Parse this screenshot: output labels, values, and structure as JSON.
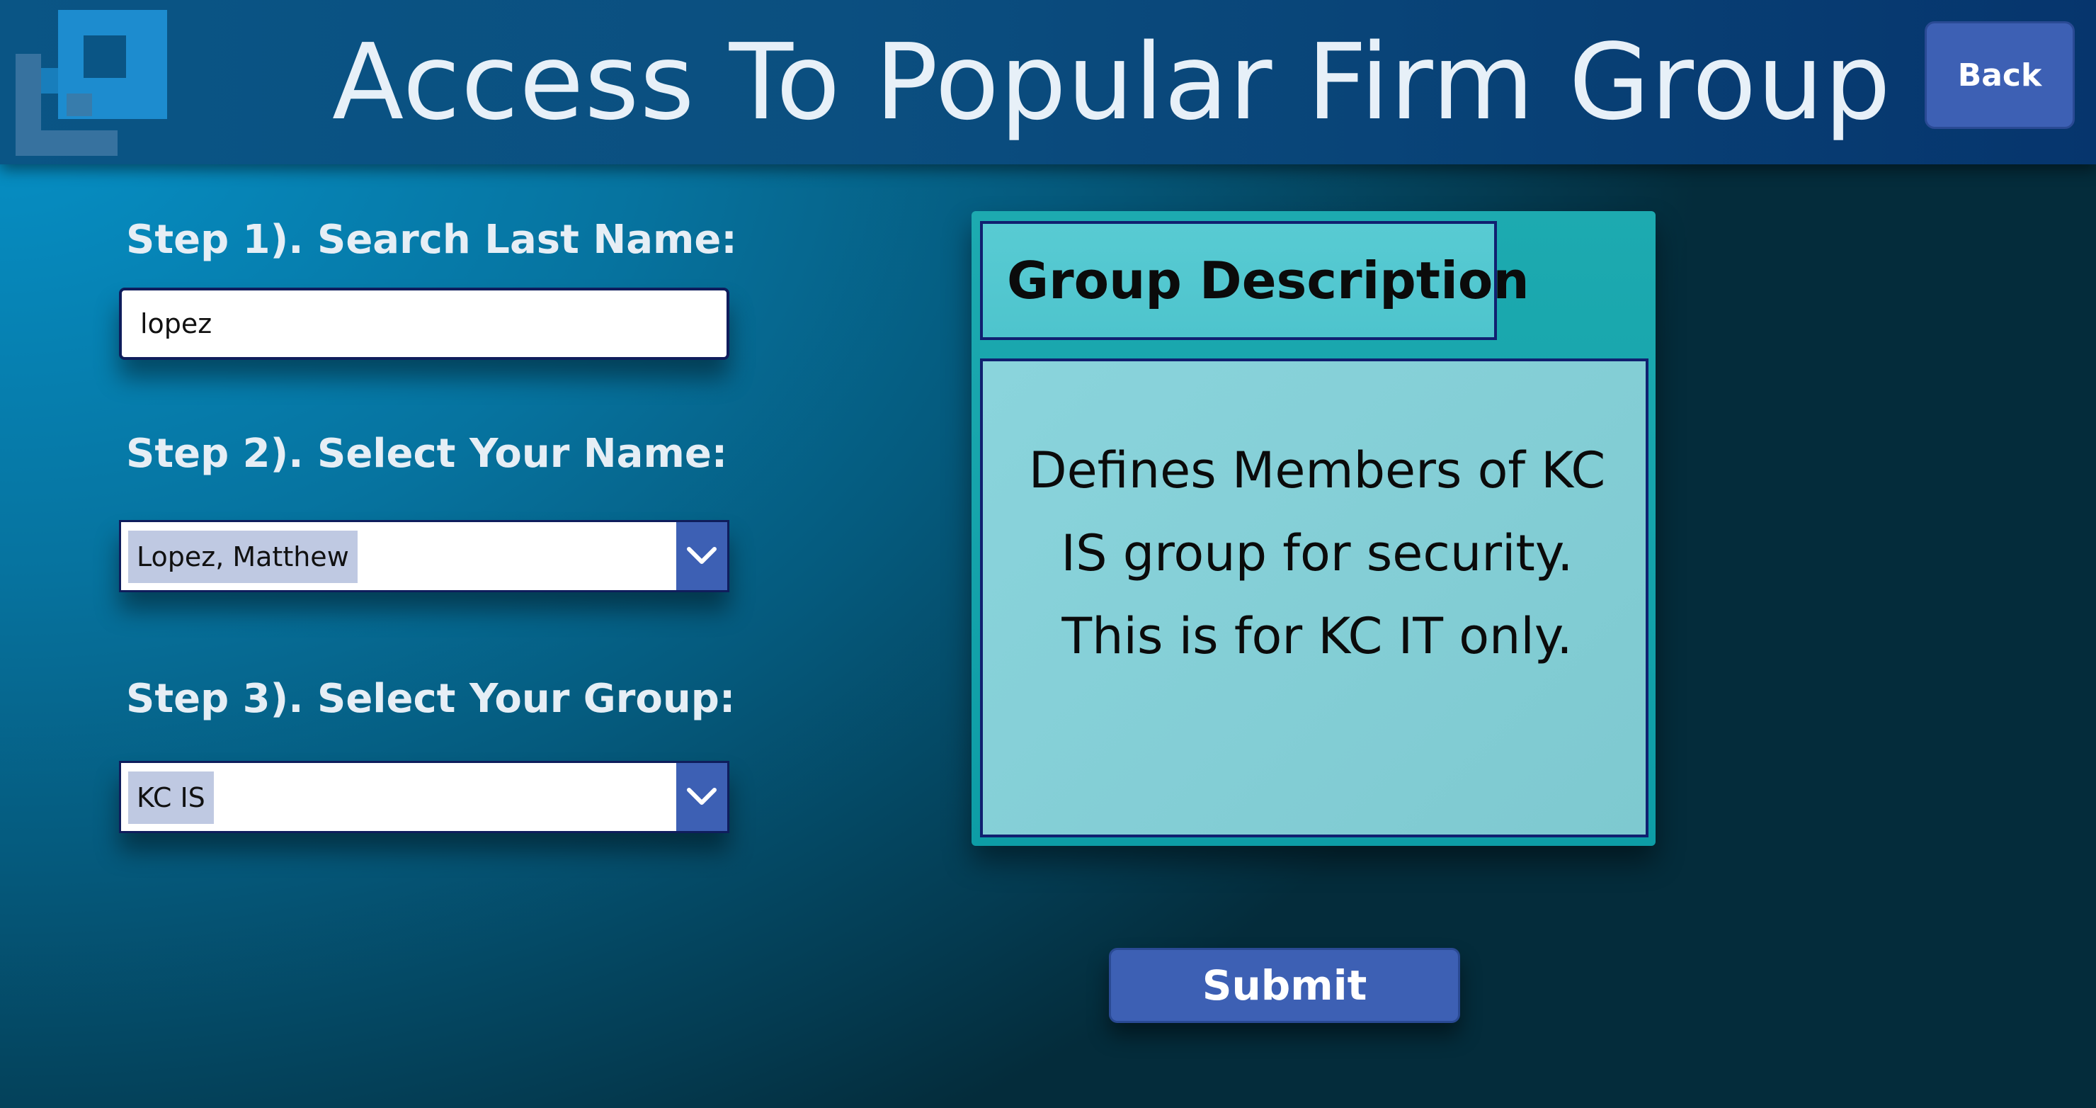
{
  "header": {
    "title": "Access To Popular Firm Group",
    "back_label": "Back",
    "logo_icon": "firm-logo-icon"
  },
  "steps": {
    "step1_label": "Step 1). Search Last Name:",
    "search_value": "lopez",
    "step2_label": "Step 2). Select Your Name:",
    "name_selected": "Lopez, Matthew",
    "step3_label": "Step 3). Select Your Group:",
    "group_selected": "KC IS"
  },
  "panel": {
    "heading": "Group Description",
    "text": "Defines Members of KC IS group for security. This is for KC IT only."
  },
  "actions": {
    "submit_label": "Submit"
  },
  "colors": {
    "button": "#3d60b4",
    "header": "#0b4f80",
    "panel": "#1daab0",
    "border": "#102070"
  }
}
